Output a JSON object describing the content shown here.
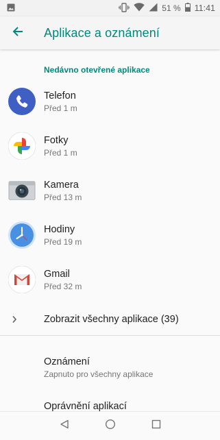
{
  "status_bar": {
    "battery_percent": "51 %",
    "time": "11:41",
    "icons": [
      "image-notification-icon",
      "vibrate-icon",
      "wifi-icon",
      "signal-icon",
      "battery-icon"
    ]
  },
  "app_bar": {
    "title": "Aplikace a oznámení",
    "back_icon": "arrow-back-icon"
  },
  "recent_section": {
    "header": "Nedávno otevřené aplikace",
    "apps": [
      {
        "name": "Telefon",
        "time": "Před 1 m",
        "icon": "phone-app-icon"
      },
      {
        "name": "Fotky",
        "time": "Před 1 m",
        "icon": "photos-app-icon"
      },
      {
        "name": "Kamera",
        "time": "Před 13 m",
        "icon": "camera-app-icon"
      },
      {
        "name": "Hodiny",
        "time": "Před 19 m",
        "icon": "clock-app-icon"
      },
      {
        "name": "Gmail",
        "time": "Před 32 m",
        "icon": "gmail-app-icon"
      }
    ],
    "show_all_label": "Zobrazit všechny aplikace (39)"
  },
  "settings": [
    {
      "title": "Oznámení",
      "summary": "Zapnuto pro všechny aplikace"
    },
    {
      "title": "Oprávnění aplikací",
      "summary": ""
    }
  ],
  "nav_bar": {
    "buttons": [
      "back-triangle-icon",
      "home-circle-icon",
      "recents-square-icon"
    ]
  },
  "colors": {
    "accent": "#00897b",
    "phone_blue": "#3f5fc4",
    "clock_blue": "#4a90e2",
    "gmail_red": "#d44638"
  }
}
